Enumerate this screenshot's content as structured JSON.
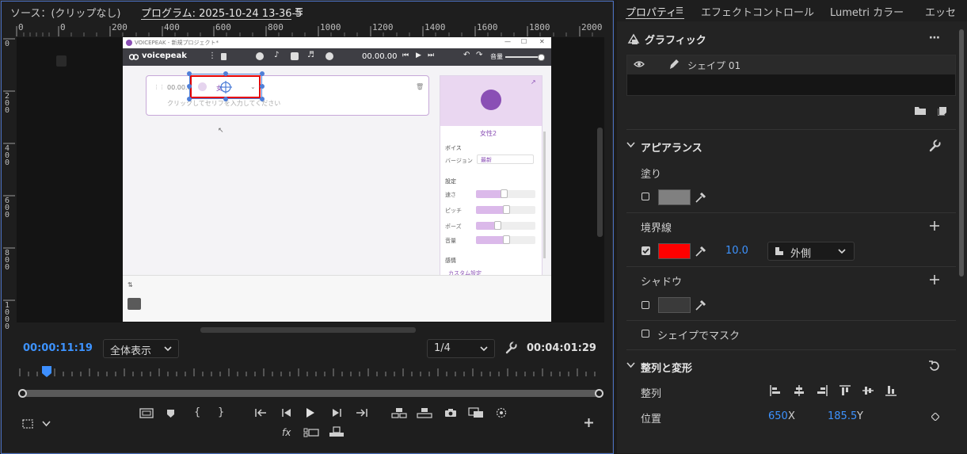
{
  "left_panel": {
    "source_tab": "ソース：(クリップなし)",
    "program_tab": "プログラム: 2025-10-24 13-36-5",
    "program_menu_icon": "hamburger-icon",
    "ruler_h": [
      "0",
      "0",
      "200",
      "400",
      "600",
      "800",
      "1000",
      "1200",
      "1400",
      "1600",
      "1800",
      "2000"
    ],
    "ruler_v": [
      "0",
      "200",
      "400",
      "600",
      "800",
      "1000"
    ],
    "current_time": "00:00:11:19",
    "zoom_select": "全体表示",
    "resolution_select": "1/4",
    "duration": "00:04:01:29",
    "wrench_icon": "wrench-icon",
    "add_button": "+",
    "fx_label": "fx"
  },
  "voicepeak": {
    "window_title": "VOICEPEAK - 新規プロジェクト*",
    "logo": "voicepeak",
    "time": "00.00.00",
    "volume_label": "音量",
    "block_time": "00.00.0",
    "block_speaker_short": "女",
    "placeholder": "クリックしてセリフを入力してください",
    "speaker": "女性2",
    "voice_section": "ボイス",
    "version_label": "バージョン",
    "version_value": "最新",
    "settings_section": "設定",
    "sliders": [
      {
        "label": "速さ",
        "value": 0.46
      },
      {
        "label": "ピッチ",
        "value": 0.5
      },
      {
        "label": "ポーズ",
        "value": 0.36
      },
      {
        "label": "音量",
        "value": 0.5
      }
    ],
    "emotion_section": "感情",
    "custom_setting": "カスタム設定"
  },
  "right_panel": {
    "tabs": [
      "プロパティ",
      "エフェクトコントロール",
      "Lumetri カラー",
      "エッセ"
    ],
    "graphic_title": "グラフィック",
    "shape_name": "シェイプ 01",
    "appearance_title": "アピアランス",
    "fill_label": "塗り",
    "fill_color": "#808080",
    "stroke_label": "境界線",
    "stroke_color": "#ff0000",
    "stroke_width": "10.0",
    "stroke_position": "外側",
    "shadow_label": "シャドウ",
    "shadow_color": "#3a3a3a",
    "mask_label": "シェイプでマスク",
    "align_title": "整列と変形",
    "align_label": "整列",
    "position_label": "位置",
    "position_x": "650",
    "position_x_unit": "X",
    "position_y": "185.5",
    "position_y_unit": "Y",
    "accent_color": "#3d93ff"
  }
}
